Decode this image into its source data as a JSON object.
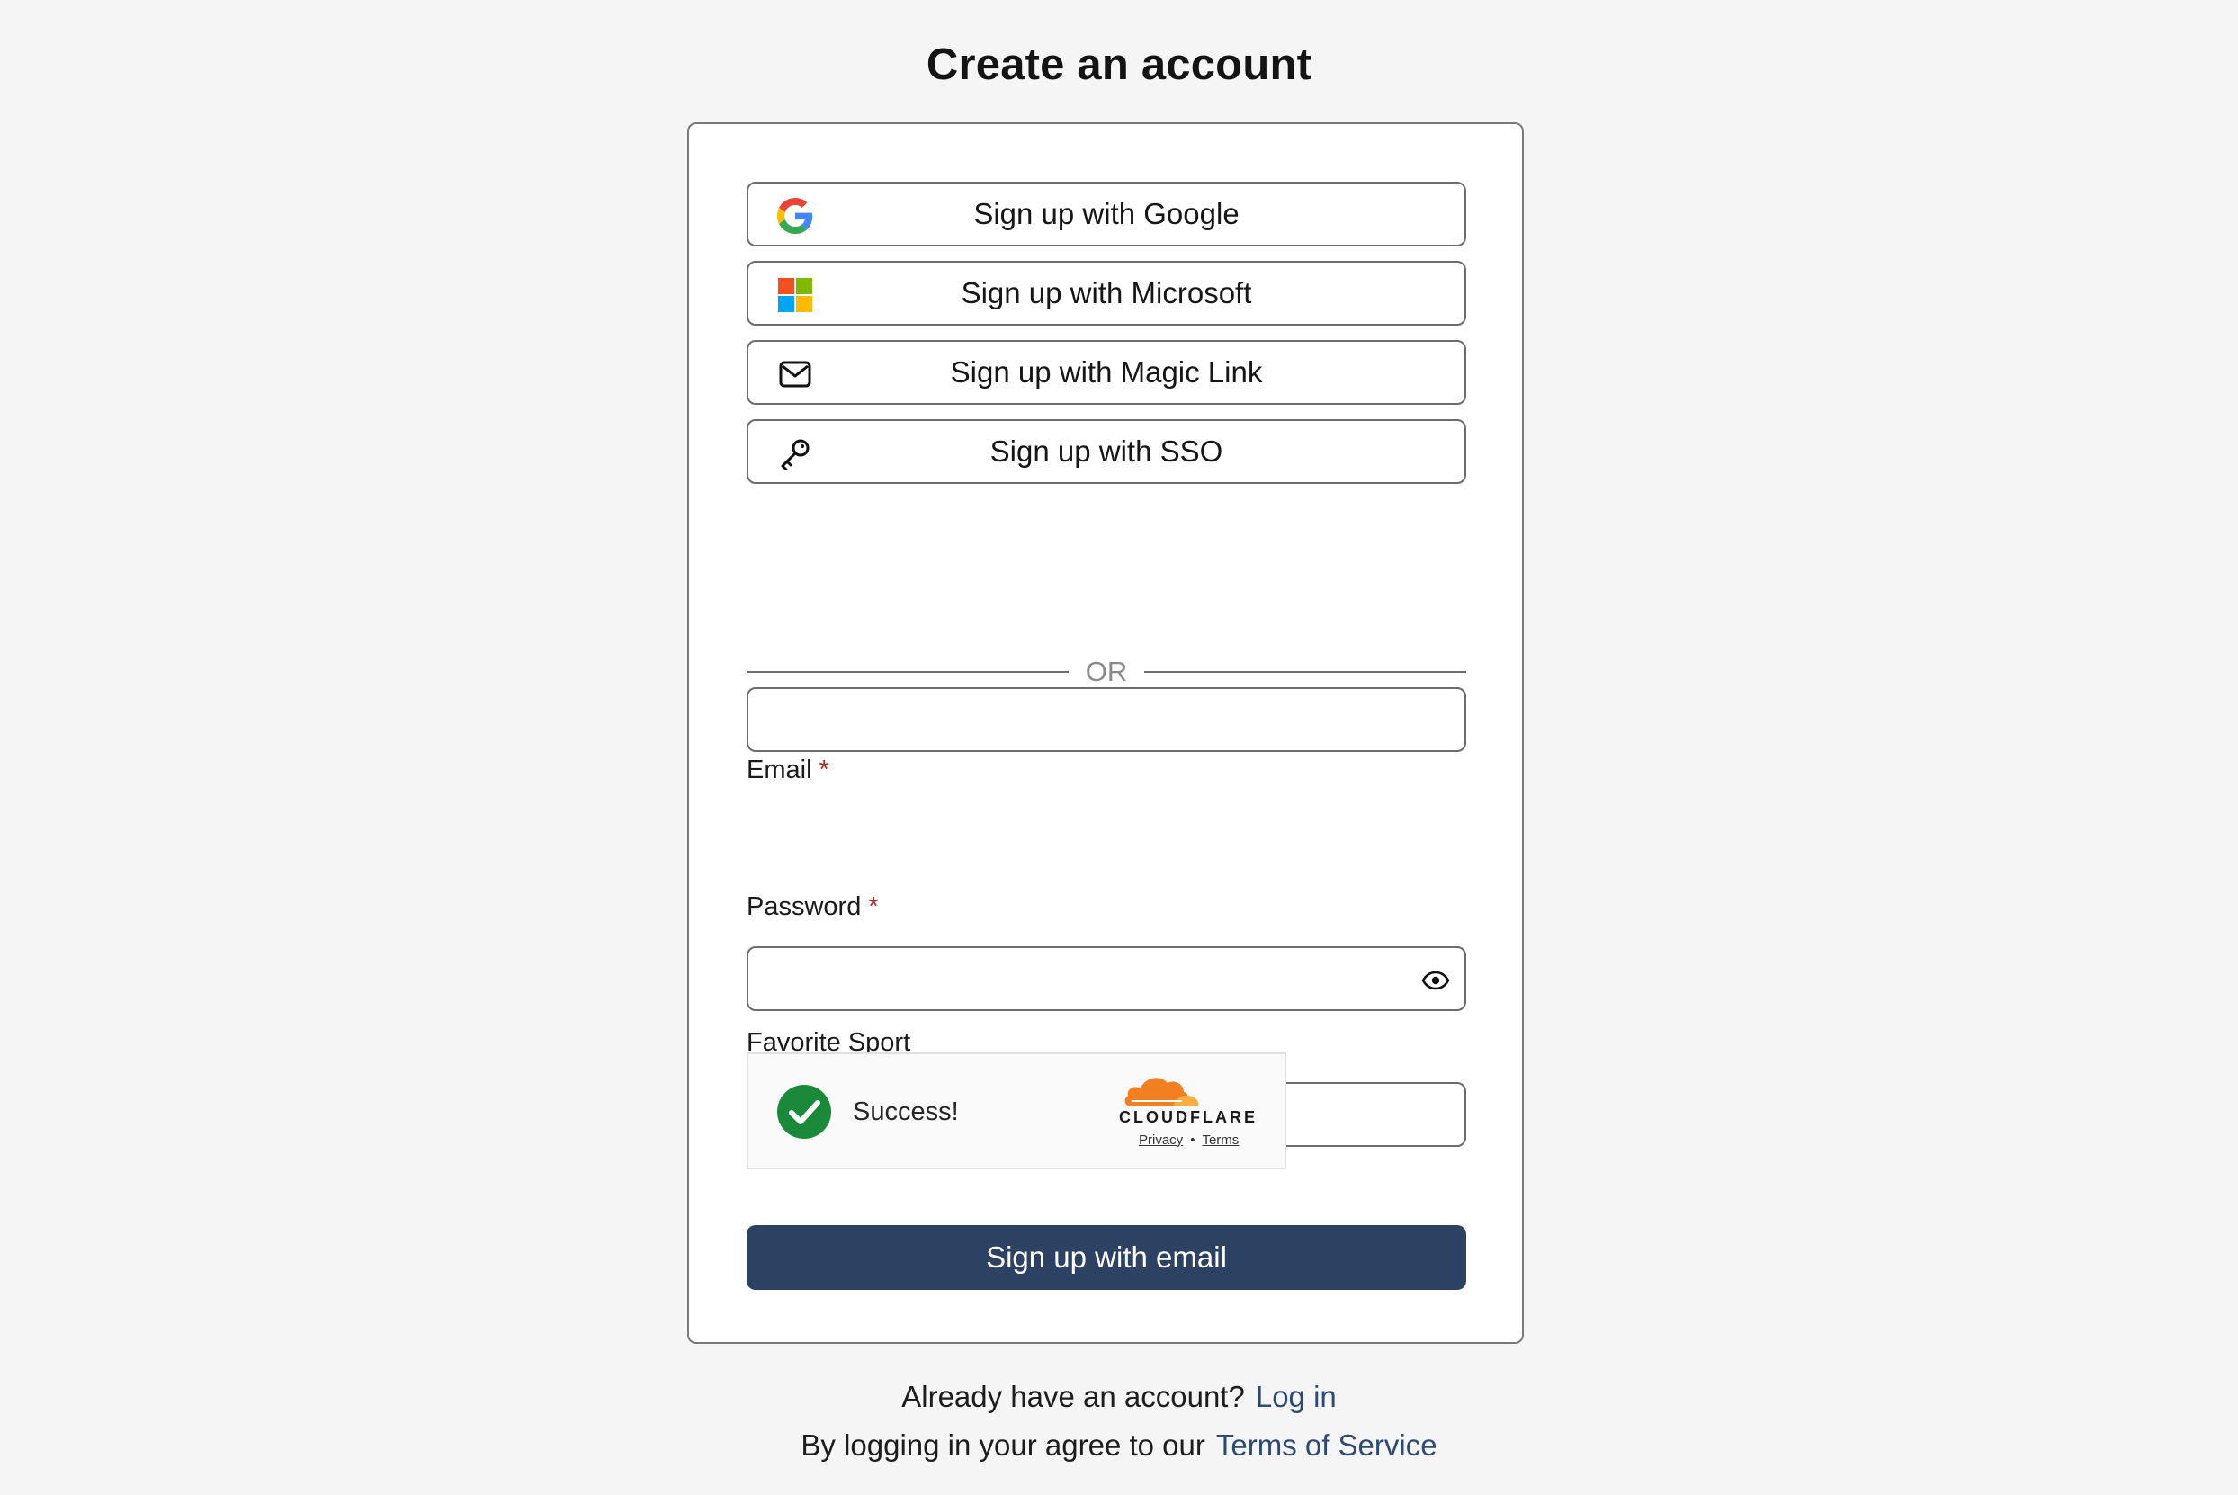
{
  "page": {
    "title": "Create an account"
  },
  "providers": {
    "google_label": "Sign up with Google",
    "google_icon": "google-icon",
    "microsoft_label": "Sign up with Microsoft",
    "microsoft_icon": "microsoft-icon",
    "magic_link_label": "Sign up with Magic Link",
    "magic_link_icon": "mail-icon",
    "sso_label": "Sign up with SSO",
    "sso_icon": "key-icon"
  },
  "divider": {
    "text": "OR"
  },
  "form": {
    "email_label": "Email",
    "email_value": "",
    "password_label": "Password",
    "password_value": "",
    "password_toggle_icon": "eye-icon",
    "favorite_sport_label": "Favorite Sport",
    "favorite_sport_value": "",
    "required_marker": "*",
    "submit_label": "Sign up with email"
  },
  "captcha": {
    "status": "Success!",
    "status_icon": "check-circle-icon",
    "brand": "CLOUDFLARE",
    "brand_icon": "cloudflare-cloud-icon",
    "privacy_link": "Privacy",
    "separator": "•",
    "terms_link": "Terms"
  },
  "footer": {
    "account_prompt": "Already have an account?",
    "login_link": "Log in",
    "agreement_text": "By logging in your agree to our",
    "tos_link": "Terms of Service"
  },
  "colors": {
    "background": "#f5f5f5",
    "card_border": "#7a7a7a",
    "primary_button": "#2d4263",
    "link": "#2e4a73",
    "required": "#b3261e",
    "success_green": "#1a8a3a",
    "cloudflare_orange": "#f38020"
  }
}
